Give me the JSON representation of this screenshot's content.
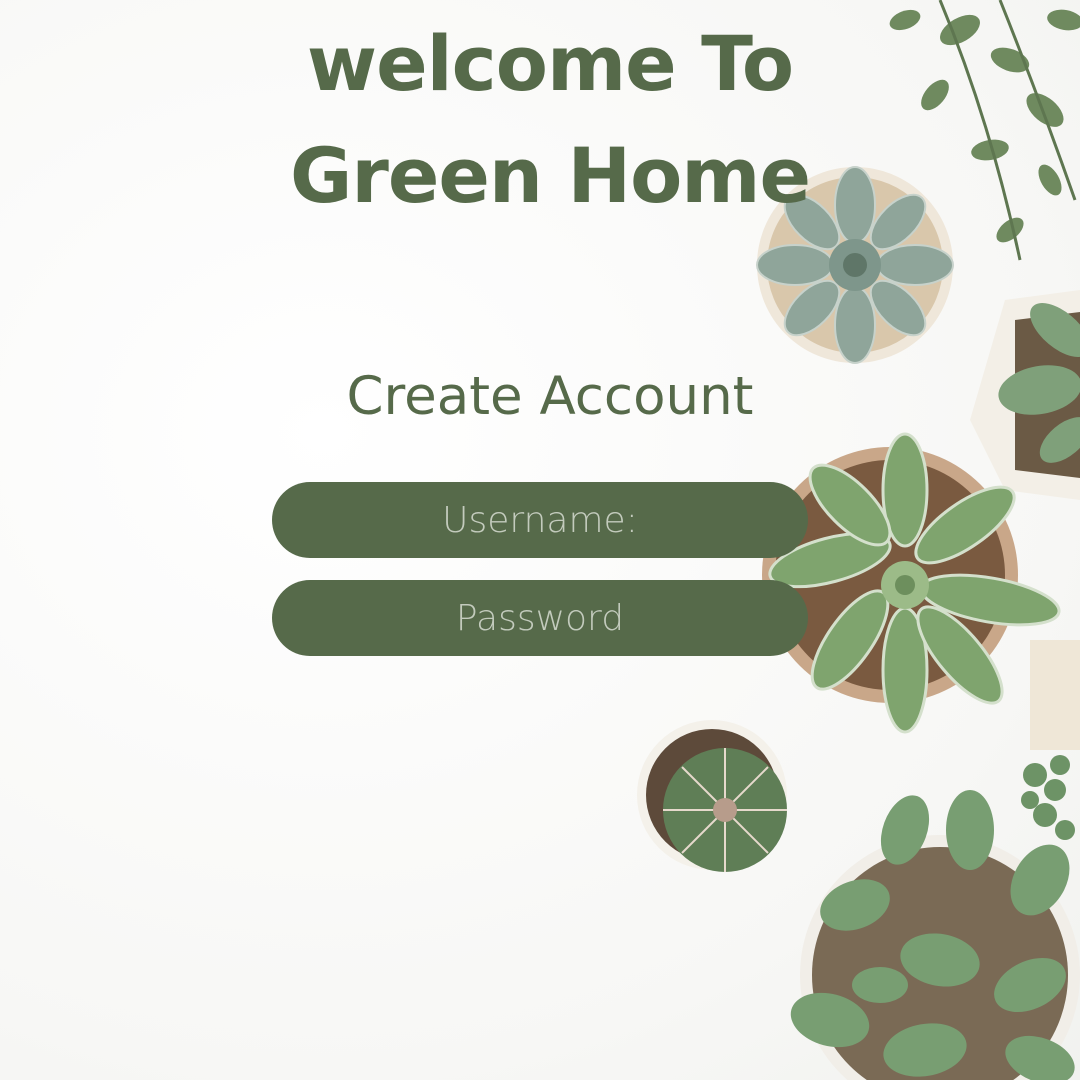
{
  "heading": {
    "line1": "welcome To",
    "line2": "Green Home"
  },
  "form": {
    "title": "Create Account",
    "username_placeholder": "Username:",
    "password_placeholder": "Password"
  },
  "theme": {
    "accent": "#566a4a",
    "background": "#fbfbfa"
  }
}
